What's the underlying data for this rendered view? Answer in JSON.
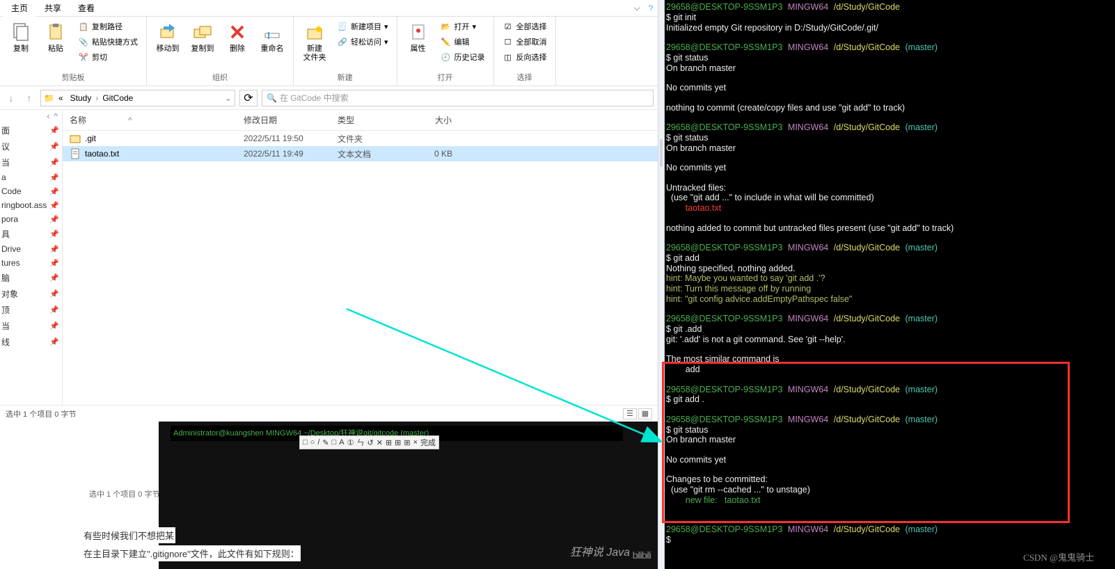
{
  "ribbonTabs": {
    "home": "主页",
    "share": "共享",
    "view": "查看"
  },
  "ribbon": {
    "clipboard": {
      "copy": "复制",
      "paste": "粘贴",
      "copyPath": "复制路径",
      "pasteShortcut": "粘贴快捷方式",
      "cut": "剪切",
      "label": "剪贴板"
    },
    "organize": {
      "moveTo": "移动到",
      "copyTo": "复制到",
      "delete": "删除",
      "rename": "重命名",
      "label": "组织"
    },
    "new": {
      "newFolder": "新建\n文件夹",
      "newItem": "新建项目",
      "easyAccess": "轻松访问",
      "label": "新建"
    },
    "open": {
      "properties": "属性",
      "open": "打开",
      "edit": "编辑",
      "history": "历史记录",
      "label": "打开"
    },
    "select": {
      "selectAll": "全部选择",
      "selectNone": "全部取消",
      "invert": "反向选择",
      "label": "选择"
    }
  },
  "breadcrumb": {
    "seg1": "Study",
    "seg2": "GitCode",
    "searchPlaceholder": "在 GitCode 中搜索"
  },
  "tree": [
    "面",
    "议",
    "当",
    "a",
    "Code",
    "ringboot.ass",
    "pora",
    "具",
    "Drive",
    "tures",
    "脑",
    "对象",
    "顶",
    "当",
    "线"
  ],
  "columns": {
    "name": "名称",
    "date": "修改日期",
    "type": "类型",
    "size": "大小"
  },
  "rows": [
    {
      "name": ".git",
      "date": "2022/5/11 19:50",
      "type": "文件夹",
      "size": "",
      "isFolder": true,
      "selected": false
    },
    {
      "name": "taotao.txt",
      "date": "2022/5/11 19:49",
      "type": "文本文档",
      "size": "0 KB",
      "isFolder": false,
      "selected": true
    }
  ],
  "status": "选中 1 个项目  0 字节",
  "video": {
    "termPrompt": "Administrator@kuangshen MINGW64 ~/Desktop/狂神说git/gitcode (master)",
    "miniStatus": "选中 1 个项目  0 字节",
    "toolbarItems": [
      "□",
      "○",
      "/",
      "✎",
      "□",
      "A",
      "①",
      "ㄣ",
      "↺",
      "✕",
      "⊞",
      "⊞",
      "⊞",
      "×",
      "完成"
    ],
    "line1": "有些时候我们不想把某",
    "line2": "在主目录下建立\".gitignore\"文件，此文件有如下规则：",
    "logo": "狂神说 Java",
    "bili": "bilibili"
  },
  "terminal": {
    "host": "29658@DESKTOP-9SSM1P3",
    "shell": "MINGW64",
    "path": "/d/Study/GitCode",
    "branch": "(master)",
    "cmd_init": "$ git init",
    "msg_init": "Initialized empty Git repository in D:/Study/GitCode/.git/",
    "cmd_status": "$ git status",
    "msg_branch": "On branch master",
    "msg_nocommits": "No commits yet",
    "msg_nothing": "nothing to commit (create/copy files and use \"git add\" to track)",
    "msg_untracked": "Untracked files:",
    "msg_useadd": "  (use \"git add <file>...\" to include in what will be committed)",
    "msg_taotao": "        taotao.txt",
    "msg_nothingadded": "nothing added to commit but untracked files present (use \"git add\" to track)",
    "cmd_add": "$ git add",
    "msg_noth_spec": "Nothing specified, nothing added.",
    "hint1": "hint: Maybe you wanted to say 'git add .'?",
    "hint2": "hint: Turn this message off by running",
    "hint3": "hint: \"git config advice.addEmptyPathspec false\"",
    "cmd_dotadd": "$ git .add",
    "msg_notcmd": "git: '.add' is not a git command. See 'git --help'.",
    "msg_similar": "The most similar command is",
    "msg_similar2": "        add",
    "cmd_add_dot": "$ git add .",
    "msg_changes": "Changes to be committed:",
    "msg_unstage": "  (use \"git rm --cached <file>...\" to unstage)",
    "msg_newfile": "        new file:   taotao.txt",
    "prompt_dollar": "$ "
  },
  "watermark": "CSDN @鬼鬼骑士"
}
